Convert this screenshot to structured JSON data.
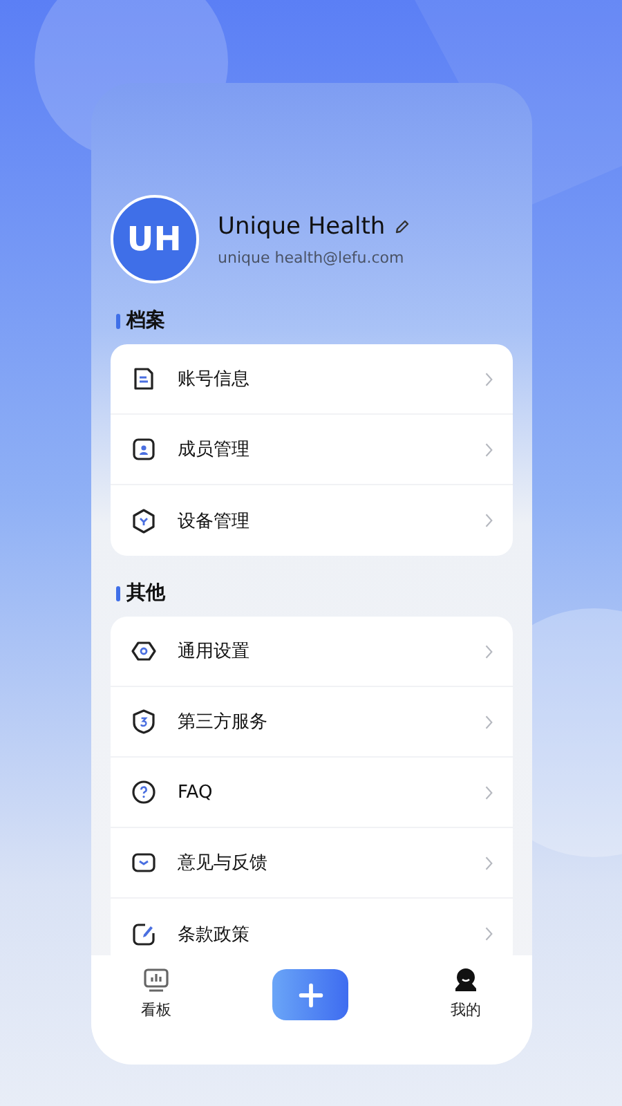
{
  "profile": {
    "avatar_text": "UH",
    "name": "Unique Health",
    "email": "unique health@lefu.com"
  },
  "sections": [
    {
      "title": "档案",
      "items": [
        {
          "label": "账号信息",
          "kind": "document"
        },
        {
          "label": "成员管理",
          "kind": "member"
        },
        {
          "label": "设备管理",
          "kind": "device"
        }
      ]
    },
    {
      "title": "其他",
      "items": [
        {
          "label": "通用设置",
          "kind": "settings"
        },
        {
          "label": "第三方服务",
          "kind": "shield"
        },
        {
          "label": "FAQ",
          "kind": "help"
        },
        {
          "label": "意见与反馈",
          "kind": "mail"
        },
        {
          "label": "条款政策",
          "kind": "edit"
        }
      ]
    }
  ],
  "tab_bar": {
    "tabs": [
      {
        "label": "看板",
        "kind": "board",
        "selected": false
      },
      {
        "label": "我的",
        "kind": "profile",
        "selected": true
      }
    ]
  }
}
